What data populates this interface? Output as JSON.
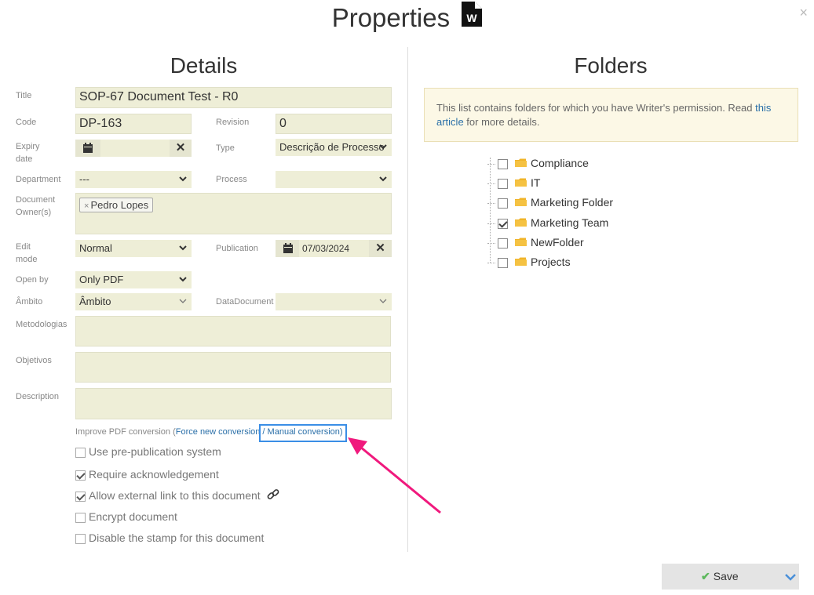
{
  "header": {
    "title": "Properties",
    "doc_icon_letter": "W",
    "close_symbol": "×"
  },
  "details": {
    "title": "Details",
    "labels": {
      "title": "Title",
      "code": "Code",
      "revision": "Revision",
      "expiry_1": "Expiry",
      "expiry_2": "date",
      "type": "Type",
      "department": "Department",
      "process": "Process",
      "owner_1": "Document",
      "owner_2": "Owner(s)",
      "edit_1": "Edit",
      "edit_2": "mode",
      "publication": "Publication",
      "open_by": "Open by",
      "ambito": "Âmbito",
      "datadocument": "DataDocument",
      "metodologias": "Metodologias",
      "objetivos": "Objetivos",
      "description": "Description"
    },
    "values": {
      "title": "SOP-67 Document Test - R0",
      "code": "DP-163",
      "revision": "0",
      "expiry_date": "",
      "type": "Descrição de Processo",
      "department": "---",
      "process": "",
      "owner_tag": "Pedro Lopes",
      "edit_mode": "Normal",
      "publication": "07/03/2024",
      "open_by": "Only PDF",
      "ambito": "Âmbito",
      "datadocument": "",
      "metodologias": "",
      "objetivos": "",
      "description": ""
    },
    "improve": {
      "prefix": "Improve PDF conversion (",
      "force": "Force new conversion",
      "sep": " / ",
      "manual": "Manual conversion",
      "suffix": ")"
    },
    "checkboxes": [
      {
        "label": "Use pre-publication system",
        "checked": false
      },
      {
        "label": "Require acknowledgement",
        "checked": true
      },
      {
        "label": "Allow external link to this document",
        "checked": true
      },
      {
        "label": "Encrypt document",
        "checked": false
      },
      {
        "label": "Disable the stamp for this document",
        "checked": false
      }
    ]
  },
  "folders": {
    "title": "Folders",
    "info_prefix": "This list contains folders for which you have Writer's permission. Read ",
    "info_link": "this article",
    "info_suffix": " for more details.",
    "items": [
      {
        "name": "Compliance",
        "checked": false
      },
      {
        "name": "IT",
        "checked": false
      },
      {
        "name": "Marketing Folder",
        "checked": false
      },
      {
        "name": "Marketing Team",
        "checked": true
      },
      {
        "name": "NewFolder",
        "checked": false
      },
      {
        "name": "Projects",
        "checked": false
      }
    ]
  },
  "footer": {
    "save_label": "Save"
  },
  "colors": {
    "field_bg": "#eeeed7",
    "highlight": "#3a8ee6",
    "arrow": "#f0197d",
    "folder": "#f0b429"
  }
}
